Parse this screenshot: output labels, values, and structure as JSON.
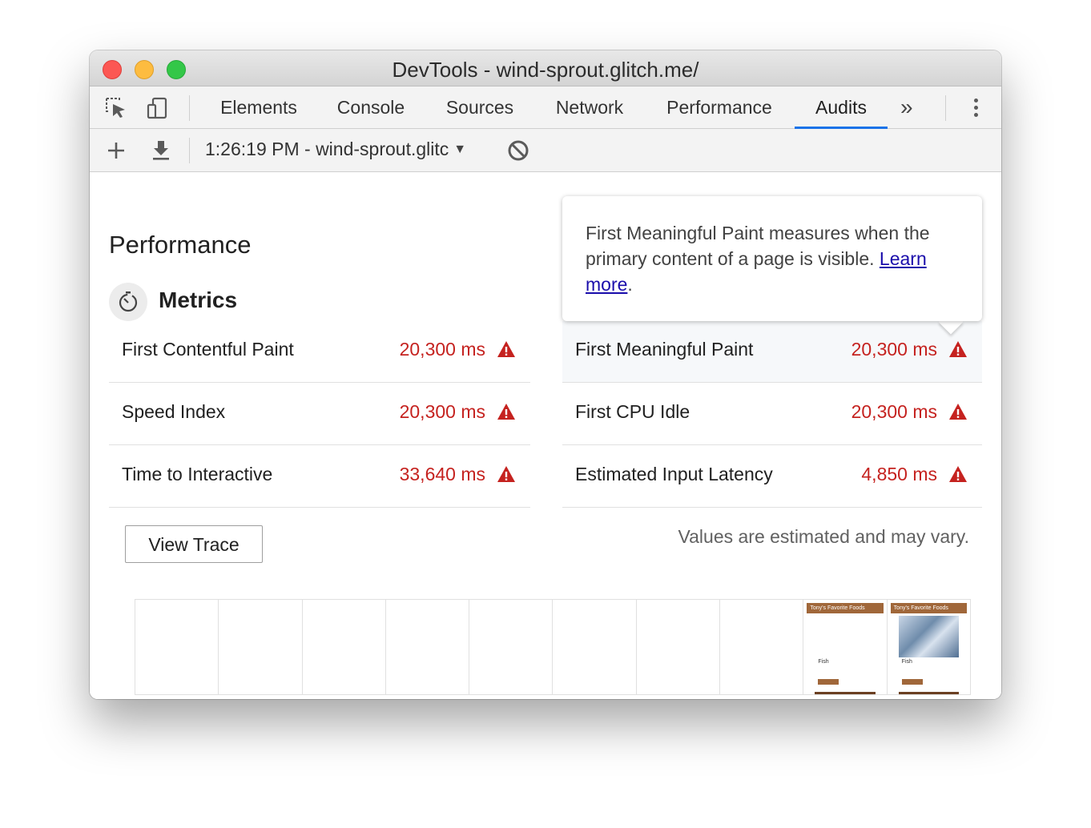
{
  "window": {
    "title": "DevTools - wind-sprout.glitch.me/"
  },
  "tabs": [
    {
      "label": "Elements"
    },
    {
      "label": "Console"
    },
    {
      "label": "Sources"
    },
    {
      "label": "Network"
    },
    {
      "label": "Performance"
    },
    {
      "label": "Audits",
      "active": true
    }
  ],
  "toolbar": {
    "report_selector": "1:26:19 PM - wind-sprout.glitc"
  },
  "section": {
    "title": "Performance",
    "metrics_title": "Metrics"
  },
  "metrics": [
    {
      "label": "First Contentful Paint",
      "value": "20,300 ms"
    },
    {
      "label": "First Meaningful Paint",
      "value": "20,300 ms"
    },
    {
      "label": "Speed Index",
      "value": "20,300 ms"
    },
    {
      "label": "First CPU Idle",
      "value": "20,300 ms"
    },
    {
      "label": "Time to Interactive",
      "value": "33,640 ms"
    },
    {
      "label": "Estimated Input Latency",
      "value": "4,850 ms"
    }
  ],
  "tooltip": {
    "text": "First Meaningful Paint measures when the primary content of a page is visible. ",
    "link": "Learn more",
    "suffix": "."
  },
  "buttons": {
    "view_trace": "View Trace"
  },
  "note": "Values are estimated and may vary.",
  "filmstrip": {
    "frames": 10,
    "thumb_header": "Tony's Favorite Foods",
    "thumb_caption": "Fish"
  },
  "colors": {
    "accent": "#1a73e8",
    "fail": "#c5221f",
    "thumb_brown": "#a0673a"
  }
}
